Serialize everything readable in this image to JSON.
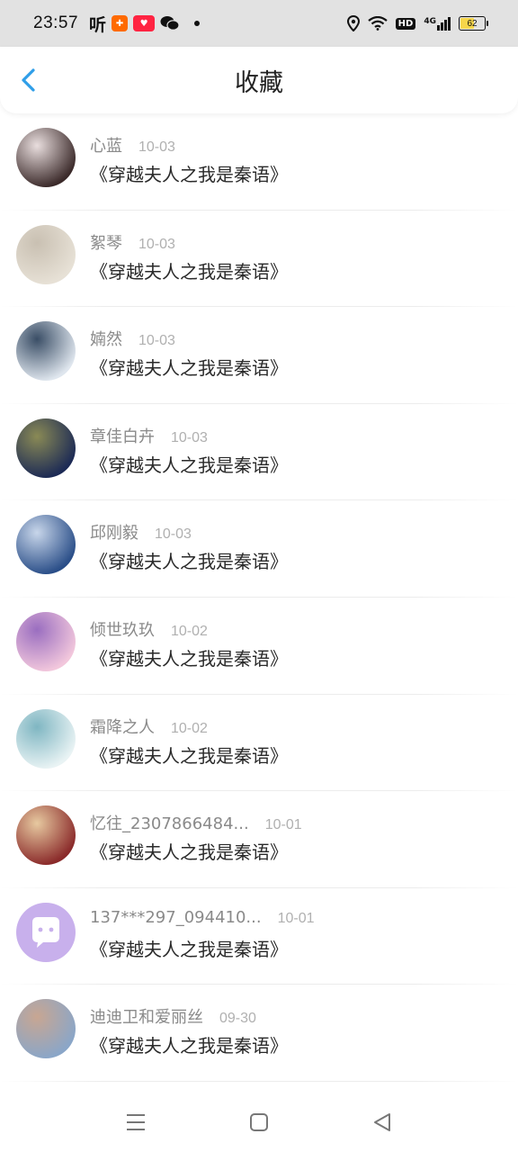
{
  "status": {
    "time": "23:57",
    "ting": "听",
    "network": "4G",
    "hd": "HD",
    "battery": "62",
    "battery_level": 0.62
  },
  "header": {
    "title": "收藏"
  },
  "items": [
    {
      "name": "心蓝",
      "date": "10-03",
      "title": "《穿越夫人之我是秦语》",
      "avatar_colors": [
        "#3b2a2a",
        "#e9dede"
      ]
    },
    {
      "name": "絮琴",
      "date": "10-03",
      "title": "《穿越夫人之我是秦语》",
      "avatar_colors": [
        "#e7e1d6",
        "#c9c0b2"
      ]
    },
    {
      "name": "婻然",
      "date": "10-03",
      "title": "《穿越夫人之我是秦语》",
      "avatar_colors": [
        "#dfe6ee",
        "#3a4e66"
      ]
    },
    {
      "name": "章佳白卉",
      "date": "10-03",
      "title": "《穿越夫人之我是秦语》",
      "avatar_colors": [
        "#1c2a55",
        "#8a8a55"
      ]
    },
    {
      "name": "邱刚毅",
      "date": "10-03",
      "title": "《穿越夫人之我是秦语》",
      "avatar_colors": [
        "#2a4e88",
        "#c8d6ea"
      ]
    },
    {
      "name": "倾世玖玖",
      "date": "10-02",
      "title": "《穿越夫人之我是秦语》",
      "avatar_colors": [
        "#f2c7dc",
        "#9a6ec0"
      ]
    },
    {
      "name": "霜降之人",
      "date": "10-02",
      "title": "《穿越夫人之我是秦语》",
      "avatar_colors": [
        "#e9f3f4",
        "#7fb6c2"
      ]
    },
    {
      "name": "忆往_2307866484...",
      "date": "10-01",
      "title": "《穿越夫人之我是秦语》",
      "avatar_colors": [
        "#8a2a2a",
        "#e7c9a0"
      ]
    },
    {
      "name": "137***297_094410...",
      "date": "10-01",
      "title": "《穿越夫人之我是秦语》",
      "avatar_colors": [
        "#c8b0ec",
        "#c8b0ec"
      ],
      "default_avatar": true
    },
    {
      "name": "迪迪卫和爱丽丝",
      "date": "09-30",
      "title": "《穿越夫人之我是秦语》",
      "avatar_colors": [
        "#8aa6c8",
        "#c8a692"
      ]
    }
  ],
  "colors": {
    "accent": "#2f9ee8",
    "title": "#2a2a2a",
    "meta": "#8a8a8a",
    "date": "#b0b0b0"
  }
}
